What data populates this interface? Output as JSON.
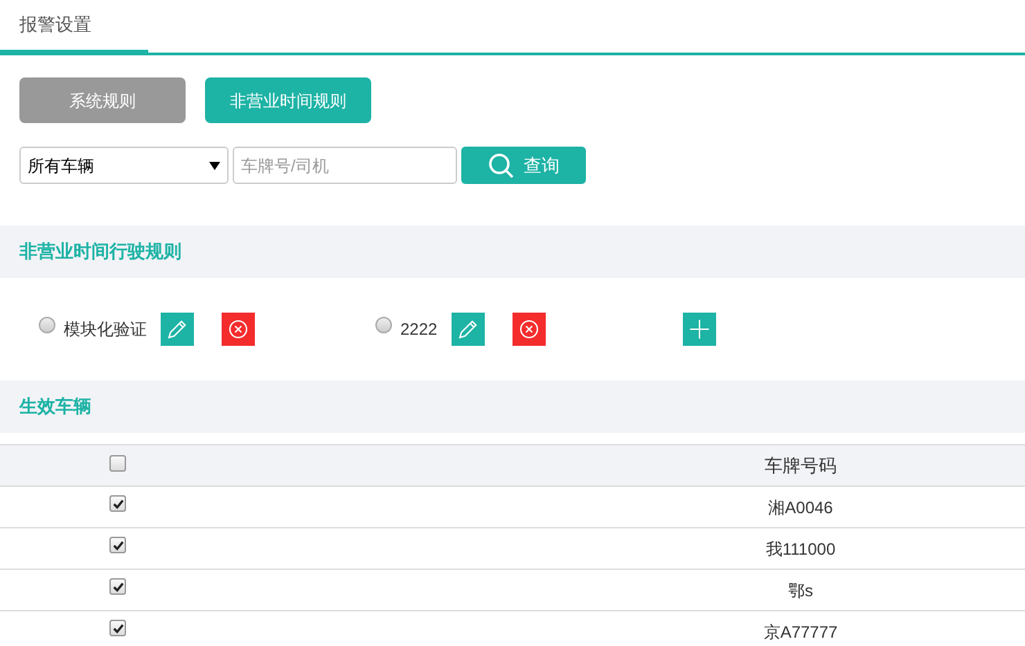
{
  "tabs": [
    {
      "label": "报警设置",
      "selected": true
    }
  ],
  "rule_buttons": [
    {
      "label": "系统规则",
      "selected": false
    },
    {
      "label": "非营业时间规则",
      "selected": true
    }
  ],
  "filter": {
    "vehicle_select": "所有车辆",
    "search_placeholder": "车牌号/司机",
    "query_button": "查询"
  },
  "rules_section": {
    "title": "非营业时间行驶规则",
    "rules": [
      {
        "name": "模块化验证",
        "selected": false
      },
      {
        "name": "2222",
        "selected": false
      }
    ]
  },
  "vehicles_section": {
    "title": "生效车辆",
    "select_all_checked": false,
    "column_header": "车牌号码",
    "rows": [
      {
        "plate": "湘A0046",
        "checked": true
      },
      {
        "plate": "我111000",
        "checked": true
      },
      {
        "plate": "鄂s",
        "checked": true
      },
      {
        "plate": "京A77777",
        "checked": true
      }
    ]
  }
}
